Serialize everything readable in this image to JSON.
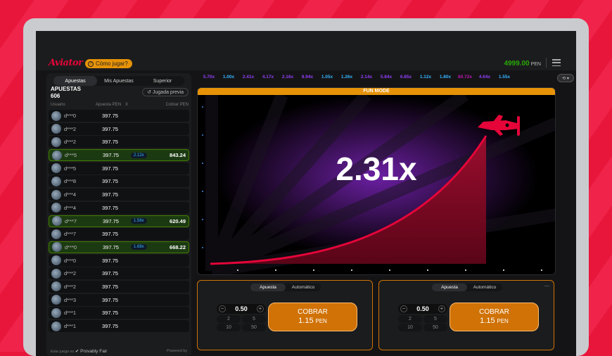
{
  "header": {
    "logo": "Aviator",
    "how_to_play": "Cómo jugar?",
    "balance": "4999.00",
    "currency": "PEN"
  },
  "tabs": [
    "Apuestas",
    "Mis Apuestas",
    "Superior"
  ],
  "bets_title": "APUESTAS",
  "bets_count": "606",
  "prev_hand": "Jugada previa",
  "columns": {
    "user": "Usuario",
    "bet": "Apuesta PEN",
    "x": "X",
    "cashout": "Cobrar PEN"
  },
  "rows": [
    {
      "user": "d***0",
      "amount": "397.75",
      "mult": "",
      "win": ""
    },
    {
      "user": "d***2",
      "amount": "397.75",
      "mult": "",
      "win": ""
    },
    {
      "user": "d***2",
      "amount": "397.75",
      "mult": "",
      "win": ""
    },
    {
      "user": "d***5",
      "amount": "397.75",
      "mult": "2.12x",
      "win": "843.24"
    },
    {
      "user": "d***5",
      "amount": "397.75",
      "mult": "",
      "win": ""
    },
    {
      "user": "d***8",
      "amount": "397.75",
      "mult": "",
      "win": ""
    },
    {
      "user": "d***4",
      "amount": "397.75",
      "mult": "",
      "win": ""
    },
    {
      "user": "d***4",
      "amount": "397.75",
      "mult": "",
      "win": ""
    },
    {
      "user": "d***7",
      "amount": "397.75",
      "mult": "1.56x",
      "win": "620.49"
    },
    {
      "user": "d***7",
      "amount": "397.75",
      "mult": "",
      "win": ""
    },
    {
      "user": "d***0",
      "amount": "397.75",
      "mult": "1.68x",
      "win": "668.22"
    },
    {
      "user": "d***0",
      "amount": "397.75",
      "mult": "",
      "win": ""
    },
    {
      "user": "d***2",
      "amount": "397.75",
      "mult": "",
      "win": ""
    },
    {
      "user": "d***2",
      "amount": "397.75",
      "mult": "",
      "win": ""
    },
    {
      "user": "d***3",
      "amount": "397.75",
      "mult": "",
      "win": ""
    },
    {
      "user": "d***1",
      "amount": "397.75",
      "mult": "",
      "win": ""
    },
    {
      "user": "d***1",
      "amount": "397.75",
      "mult": "",
      "win": ""
    }
  ],
  "footer": {
    "left": "Este juego es",
    "provably": "Provably Fair",
    "powered": "Powered by"
  },
  "history": [
    "5.70x",
    "1.00x",
    "2.41x",
    "4.17x",
    "2.16x",
    "8.94x",
    "1.05x",
    "1.26x",
    "2.14x",
    "5.84x",
    "6.85x",
    "1.12x",
    "1.80x",
    "60.72x",
    "4.64x",
    "1.55x"
  ],
  "game": {
    "mode": "FUN MODE",
    "multiplier": "2.31x"
  },
  "bet_panels": [
    {
      "tabs": [
        "Apuesta",
        "Automático"
      ],
      "stake": "0.50",
      "quick": [
        "2",
        "5",
        "10",
        "50"
      ],
      "cashout_label": "COBRAR",
      "cashout_amount": "1.15",
      "cashout_currency": "PEN"
    },
    {
      "tabs": [
        "Apuesta",
        "Automático"
      ],
      "stake": "0.50",
      "quick": [
        "2",
        "5",
        "10",
        "50"
      ],
      "cashout_label": "COBRAR",
      "cashout_amount": "1.15",
      "cashout_currency": "PEN"
    }
  ]
}
